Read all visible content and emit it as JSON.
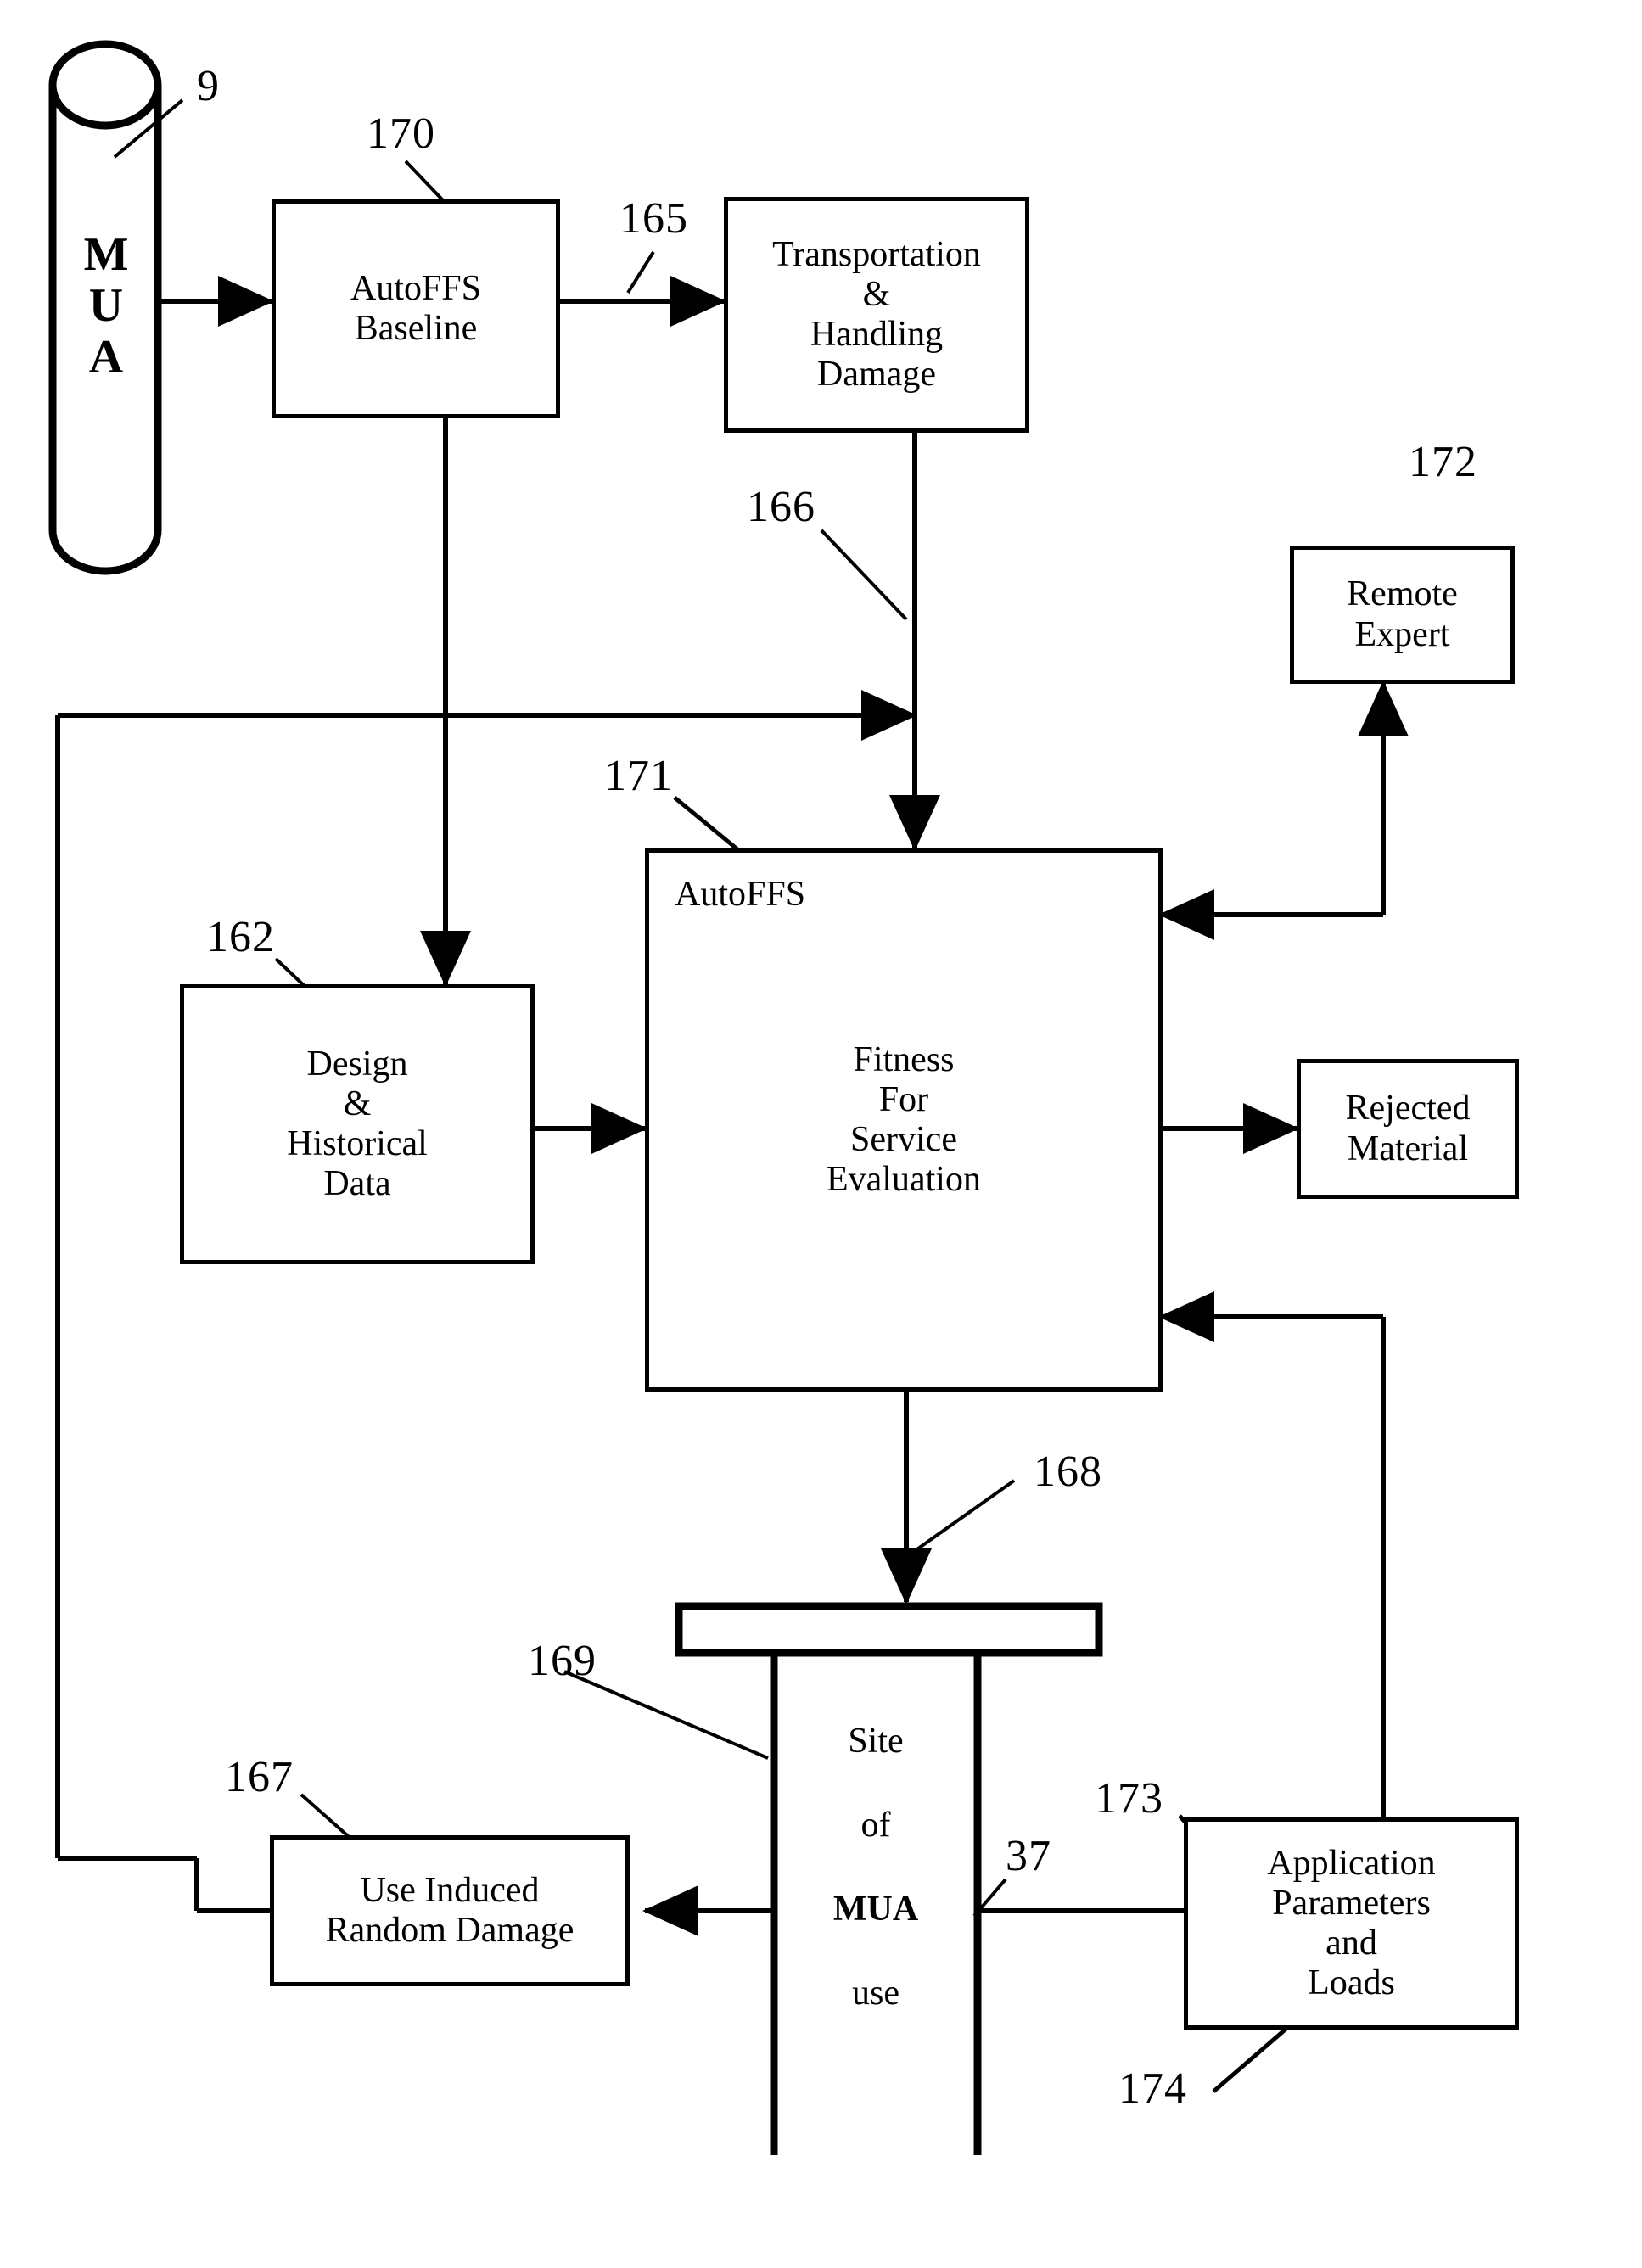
{
  "figure": {
    "type": "patent-flow-diagram",
    "background": "#ffffff",
    "stroke": "#000000"
  },
  "cylinder": {
    "name": "MUA",
    "letters": [
      "M",
      "U",
      "A"
    ],
    "ref": "9"
  },
  "nodes": {
    "autoffs_baseline": {
      "label": "AutoFFS\nBaseline",
      "ref": "170"
    },
    "transportation": {
      "label": "Transportation\n&\nHandling\nDamage",
      "ref": "165"
    },
    "remote_expert": {
      "label": "Remote\nExpert",
      "ref": "172"
    },
    "autoffs": {
      "corner_label": "AutoFFS",
      "label": "Fitness\nFor\nService\nEvaluation",
      "ref": "171"
    },
    "design_data": {
      "label": "Design\n&\nHistorical\nData",
      "ref": "162"
    },
    "rejected_material": {
      "label": "Rejected\nMaterial",
      "ref": ""
    },
    "use_induced_damage": {
      "label": "Use Induced\nRandom Damage",
      "ref": "167"
    },
    "application_parameters": {
      "label": "Application\nParameters\nand\nLoads",
      "ref": "173",
      "ref2": "174"
    },
    "site_of_use": {
      "label_line1": "Site",
      "label_line2": "of",
      "label_line3": "MUA",
      "label_line4": "use",
      "ref": "169",
      "ref_bar": "168",
      "ref_leg": "37"
    }
  },
  "refs": {
    "r9": "9",
    "r37": "37",
    "r162": "162",
    "r165": "165",
    "r166": "166",
    "r167": "167",
    "r168": "168",
    "r169": "169",
    "r170": "170",
    "r171": "171",
    "r172": "172",
    "r173": "173",
    "r174": "174"
  }
}
